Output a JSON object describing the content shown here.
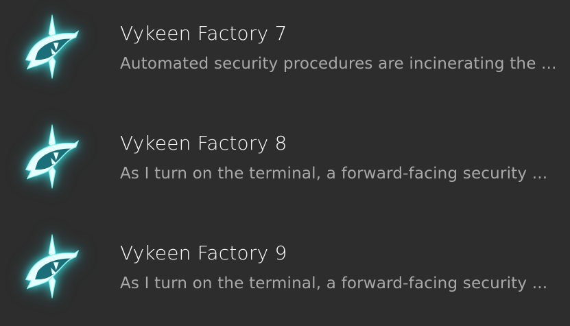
{
  "accent_color": "#5ee6e6",
  "entries": [
    {
      "icon": "vykeen-sentinel-eye-icon",
      "title": "Vykeen Factory 7",
      "snippet": "Automated security procedures are incinerating the ..."
    },
    {
      "icon": "vykeen-sentinel-eye-icon",
      "title": "Vykeen Factory 8",
      "snippet": "As I turn on the terminal, a forward-facing security ..."
    },
    {
      "icon": "vykeen-sentinel-eye-icon",
      "title": "Vykeen Factory 9",
      "snippet": "As I turn on the terminal, a forward-facing security ..."
    }
  ]
}
